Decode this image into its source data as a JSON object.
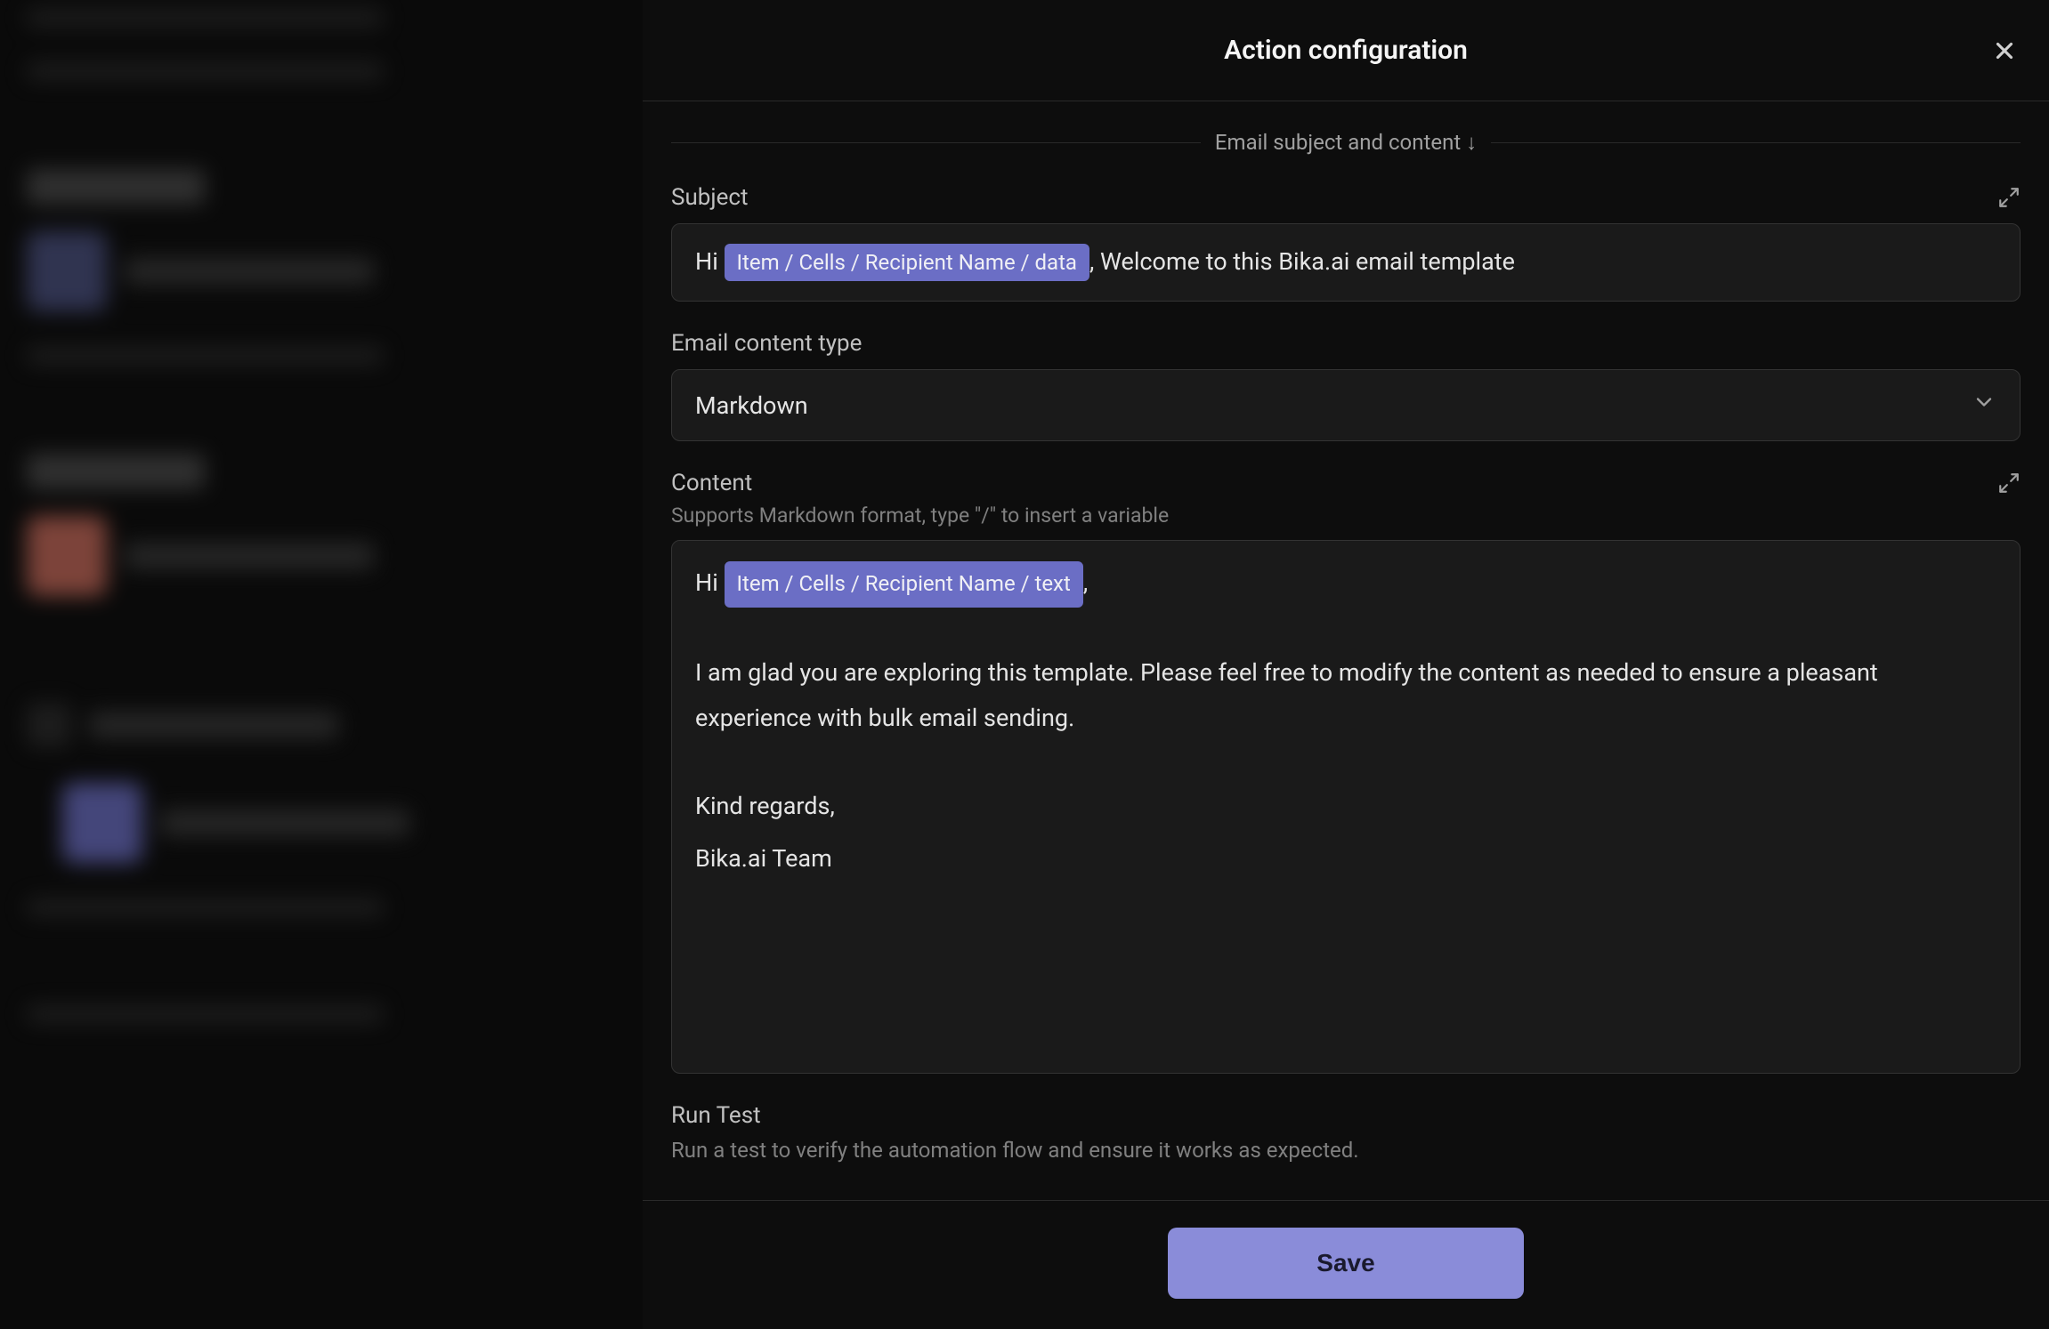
{
  "panel": {
    "title": "Action configuration",
    "divider_label": "Email subject and content ↓",
    "save_button": "Save"
  },
  "subject": {
    "label": "Subject",
    "prefix": "Hi ",
    "variable": "Item / Cells / Recipient Name / data",
    "suffix": ", Welcome to this Bika.ai email template"
  },
  "content_type": {
    "label": "Email content type",
    "value": "Markdown"
  },
  "content": {
    "label": "Content",
    "hint": "Supports Markdown format, type \"/\" to insert a variable",
    "greeting_prefix": "Hi ",
    "greeting_variable": "Item / Cells / Recipient Name / text",
    "greeting_suffix": ",",
    "body": "I am glad you are exploring this template. Please feel free to modify the content as needed to ensure a pleasant experience with bulk email sending.",
    "signature1": "Kind regards,",
    "signature2": "Bika.ai Team"
  },
  "runtest": {
    "title": "Run Test",
    "description": "Run a test to verify the automation flow and ensure it works as expected."
  }
}
